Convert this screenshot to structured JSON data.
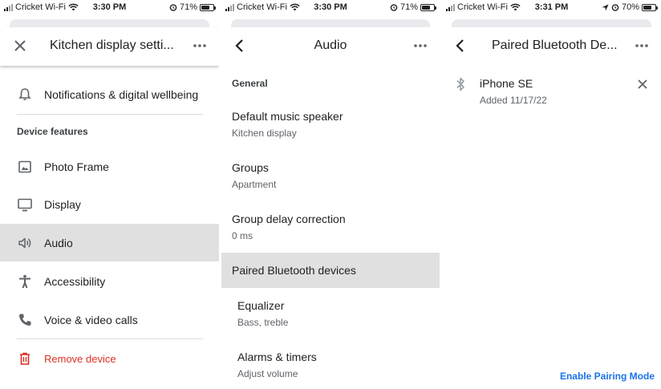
{
  "status_bars": [
    {
      "carrier": "Cricket Wi-Fi",
      "time": "3:30 PM",
      "battery": "71%",
      "battery_level": 0.71,
      "location_arrow": false
    },
    {
      "carrier": "Cricket Wi-Fi",
      "time": "3:30 PM",
      "battery": "71%",
      "battery_level": 0.71,
      "location_arrow": false
    },
    {
      "carrier": "Cricket Wi-Fi",
      "time": "3:31 PM",
      "battery": "70%",
      "battery_level": 0.7,
      "location_arrow": true
    }
  ],
  "panel1": {
    "title": "Kitchen display setti...",
    "lead_icon": "close-icon",
    "menu_icon": "more-horizontal-icon",
    "top_item": {
      "label": "Notifications & digital wellbeing",
      "icon": "bell-icon"
    },
    "section_label": "Device features",
    "features": [
      {
        "label": "Photo Frame",
        "icon": "photo-icon",
        "selected": false
      },
      {
        "label": "Display",
        "icon": "monitor-icon",
        "selected": false
      },
      {
        "label": "Audio",
        "icon": "speaker-icon",
        "selected": true
      },
      {
        "label": "Accessibility",
        "icon": "accessibility-icon",
        "selected": false
      },
      {
        "label": "Voice & video calls",
        "icon": "phone-icon",
        "selected": false
      }
    ],
    "remove": {
      "label": "Remove device",
      "icon": "trash-icon",
      "color": "#d93025"
    }
  },
  "panel2": {
    "title": "Audio",
    "lead_icon": "back-arrow-icon",
    "menu_icon": "more-horizontal-icon",
    "section_label": "General",
    "items": [
      {
        "title": "Default music speaker",
        "subtitle": "Kitchen display",
        "selected": false
      },
      {
        "title": "Groups",
        "subtitle": "Apartment",
        "selected": false
      },
      {
        "title": "Group delay correction",
        "subtitle": "0 ms",
        "selected": false
      },
      {
        "title": "Paired Bluetooth devices",
        "subtitle": "",
        "selected": true
      },
      {
        "title": "Equalizer",
        "subtitle": "Bass, treble",
        "selected": false
      },
      {
        "title": "Alarms & timers",
        "subtitle": "Adjust volume",
        "selected": false
      }
    ]
  },
  "panel3": {
    "title": "Paired Bluetooth De...",
    "lead_icon": "back-arrow-icon",
    "menu_icon": "more-horizontal-icon",
    "device": {
      "name": "iPhone SE",
      "added": "Added 11/17/22",
      "icon": "bluetooth-icon"
    },
    "pairing_link": "Enable Pairing Mode"
  },
  "colors": {
    "selected_bg": "#e0e0e0",
    "danger": "#d93025",
    "link": "#1a73e8",
    "divider": "#dadce0"
  }
}
